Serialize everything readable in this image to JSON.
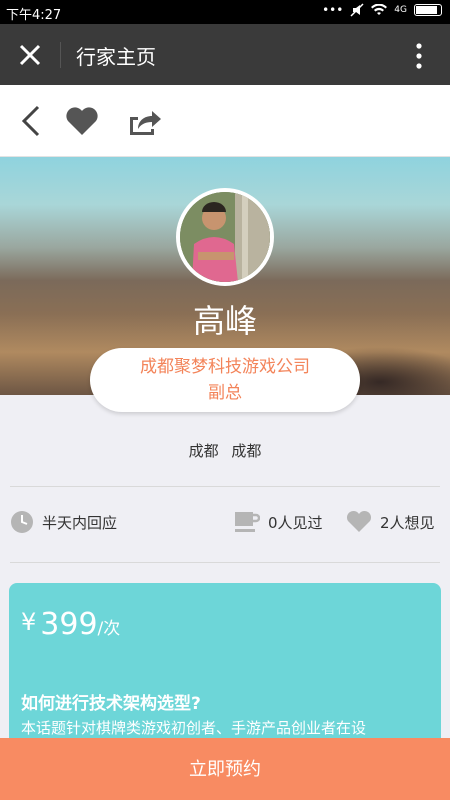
{
  "status": {
    "time": "下午4:27",
    "network": "4G",
    "battery_fraction": 0.85
  },
  "appbar": {
    "title": "行家主页"
  },
  "profile": {
    "name": "高峰",
    "company": "成都聚梦科技游戏公司",
    "position": "副总",
    "city": [
      "成都",
      "成都"
    ]
  },
  "stats": {
    "response": "半天内回应",
    "met": "0人见过",
    "want": "2人想见"
  },
  "topic": {
    "currency": "¥",
    "price": "399",
    "unit": "/次",
    "title": "如何进行技术架构选型?",
    "description": "本话题针对棋牌类游戏初创者、手游产品创业者在设"
  },
  "actions": {
    "book": "立即预约"
  },
  "colors": {
    "accent": "#f88b62",
    "card": "#6dd6d8",
    "appbar": "#3a3a3a"
  }
}
